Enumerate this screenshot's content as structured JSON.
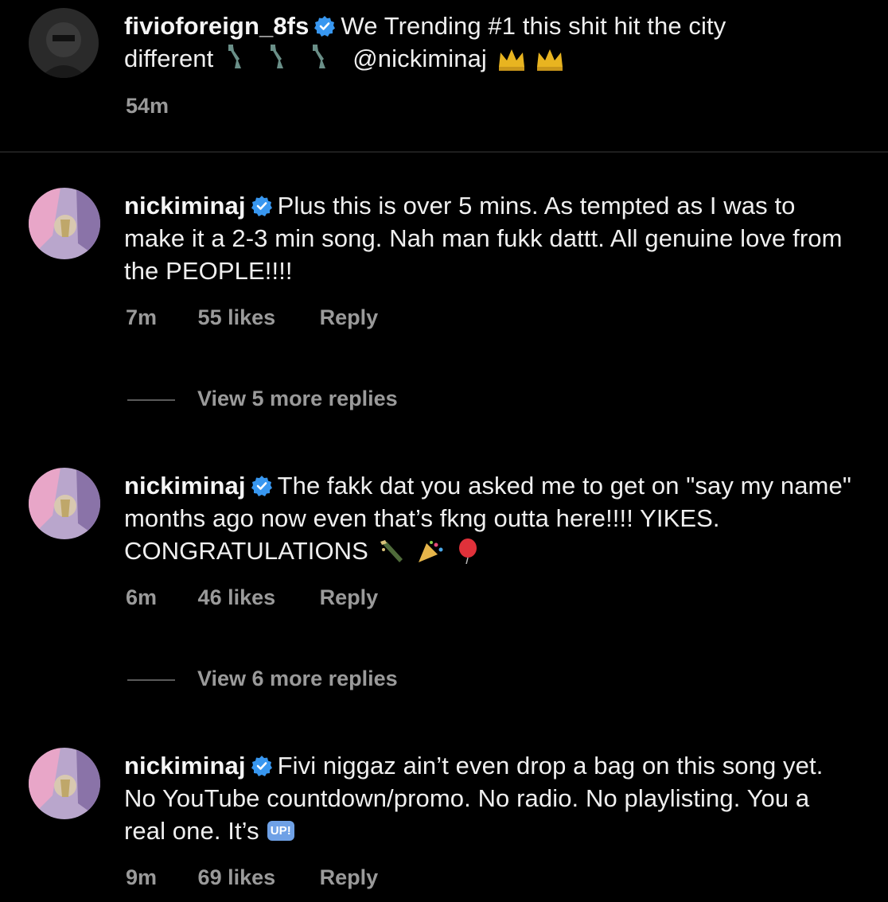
{
  "caption": {
    "username": "fivioforeign_8fs",
    "text_line1": "We Trending #1 this shit hit the city",
    "text_line2_prefix": "different",
    "text_line2_mention": "@nickiminaj",
    "time": "54m",
    "emojis": [
      "statue-of-liberty-icon",
      "statue-of-liberty-icon",
      "statue-of-liberty-icon",
      "crown-icon",
      "crown-icon"
    ]
  },
  "comments": [
    {
      "username": "nickiminaj",
      "text": "Plus this is over 5 mins. As tempted as I was to make it a 2-3 min song. Nah man fukk dattt. All genuine love from the PEOPLE!!!!",
      "time": "7m",
      "likes": "55 likes",
      "reply": "Reply",
      "view_replies": "View 5 more replies"
    },
    {
      "username": "nickiminaj",
      "text": "The fakk dat you asked me to get on \"say my name\" months ago now even that’s fkng outta here!!!! YIKES. CONGRATULATIONS",
      "time": "6m",
      "likes": "46 likes",
      "reply": "Reply",
      "view_replies": "View 6 more replies",
      "emojis": [
        "champagne-icon",
        "party-popper-icon",
        "balloon-icon"
      ]
    },
    {
      "username": "nickiminaj",
      "text": "Fivi niggaz ain’t even drop a bag on this song yet. No YouTube countdown/promo. No radio. No playlisting. You a real one. It’s",
      "badge": "UP!",
      "time": "9m",
      "likes": "69 likes",
      "reply": "Reply"
    }
  ],
  "colors": {
    "background": "#000000",
    "text": "#f5f5f5",
    "meta": "#9a9a9a",
    "verified": "#3897f0",
    "up_badge": "#6fa1e6"
  }
}
